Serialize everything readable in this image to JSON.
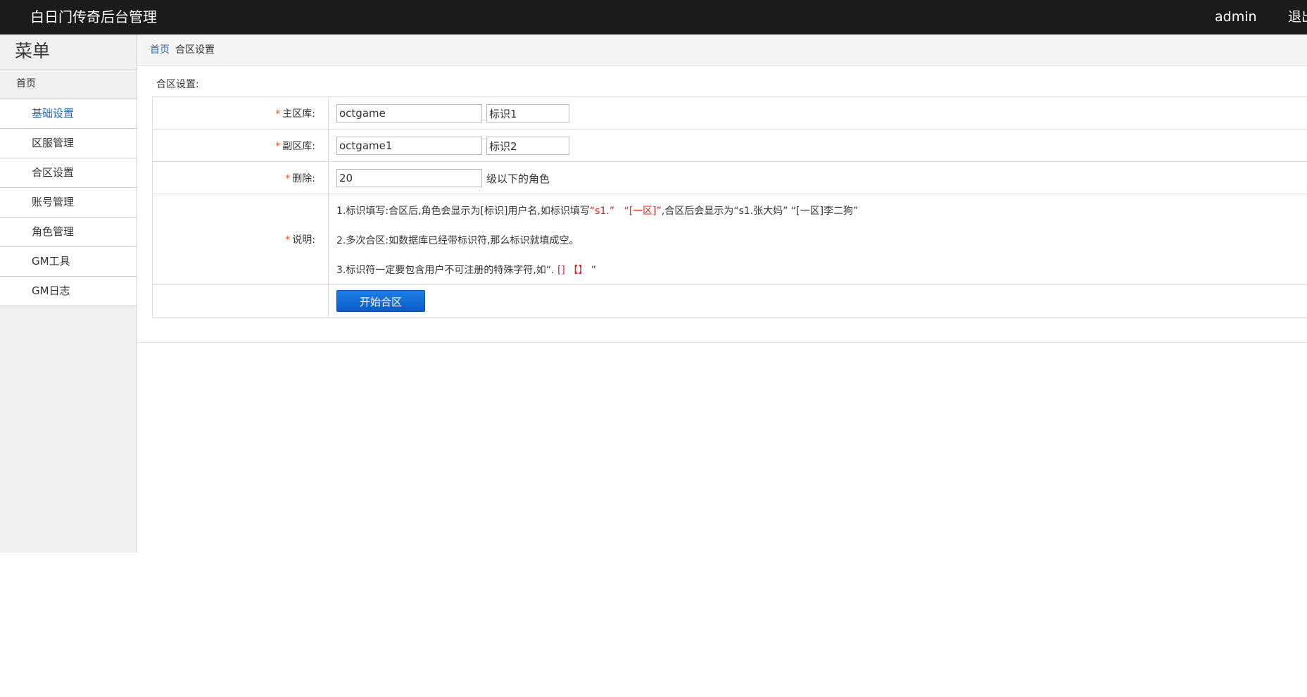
{
  "header": {
    "app_title": "白日门传奇后台管理",
    "user": "admin",
    "logout": "退出"
  },
  "sidebar": {
    "title": "菜单",
    "home": "首页",
    "items": [
      {
        "label": "基础设置",
        "active": true
      },
      {
        "label": "区服管理",
        "active": false
      },
      {
        "label": "合区设置",
        "active": false
      },
      {
        "label": "账号管理",
        "active": false
      },
      {
        "label": "角色管理",
        "active": false
      },
      {
        "label": "GM工具",
        "active": false
      },
      {
        "label": "GM日志",
        "active": false
      }
    ]
  },
  "breadcrumb": {
    "home": "首页",
    "current": "合区设置"
  },
  "form": {
    "section_title": "合区设置:",
    "required_mark": "*",
    "main_db": {
      "label": "主区库:",
      "db_value": "octgame",
      "tag_value": "标识1"
    },
    "sub_db": {
      "label": "副区库:",
      "db_value": "octgame1",
      "tag_value": "标识2"
    },
    "delete": {
      "label": "删除:",
      "value": "20",
      "suffix": "级以下的角色"
    },
    "notes": {
      "label": "说明:",
      "line1": {
        "p1": "1.标识填写:合区后,角色会显示为[标识]用户名,如标识填写",
        "red1": "“s1.”",
        "red2": "“[一区]”",
        "p2": ",合区后会显示为“s1.张大妈”  “[一区]李二狗”"
      },
      "line2": "2.多次合区:如数据库已经带标识符,那么标识就填成空。",
      "line3": {
        "p1": "3.标识符一定要包含用户不可注册的特殊字符,如“",
        "dot": ".",
        "red": "[]  【】",
        "p2": "”"
      }
    },
    "submit_label": "开始合区"
  }
}
